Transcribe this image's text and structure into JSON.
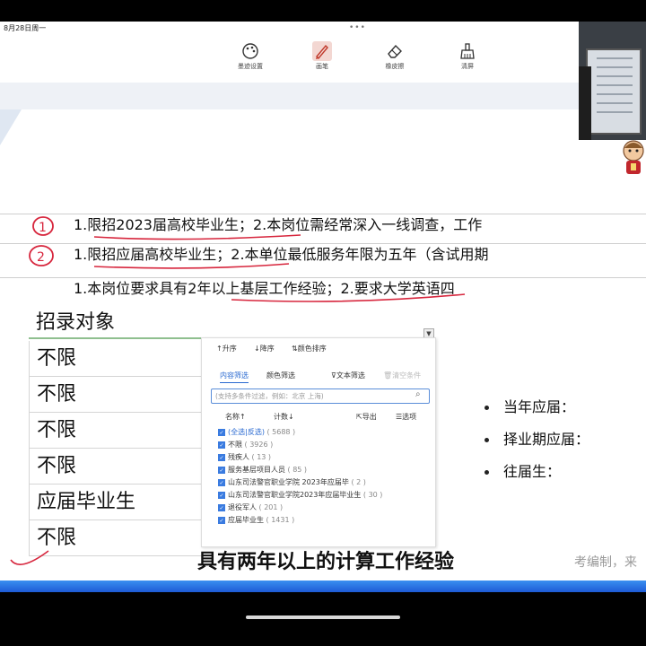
{
  "status_bar": {
    "date": "8月28日周一",
    "dots": "•••"
  },
  "toolbar": {
    "ink_settings": "墨迹设置",
    "pen": "画笔",
    "eraser": "橡皮擦",
    "clear": "清屏"
  },
  "rows": [
    {
      "text": "1.限招2023届高校毕业生；2.本岗位需经常深入一线调查，工作"
    },
    {
      "text": "1.限招应届高校毕业生；2.本单位最低服务年限为五年（含试用期"
    },
    {
      "text": "1.本岗位要求具有2年以上基层工作经验；2.要求大学英语四"
    }
  ],
  "table": {
    "header": "招录对象",
    "cells": [
      "不限",
      "不限",
      "不限",
      "不限",
      "应届毕业生",
      "不限"
    ],
    "dropdown_glyph": "▼"
  },
  "filter_panel": {
    "sort_asc": "升序",
    "sort_desc": "降序",
    "sort_color": "颜色排序",
    "tab_content": "内容筛选",
    "tab_color": "颜色筛选",
    "text_filter": "文本筛选",
    "clear_conditions": "清空条件",
    "search_placeholder": "(支持多条件过滤，例如：北京 上海)",
    "col_name": "名称↑",
    "col_count": "计数↓",
    "export": "导出",
    "options": "选项",
    "select_all": "全选",
    "invert": "反选",
    "items": [
      {
        "label": "(全选|反选)",
        "count": "( 5688 )"
      },
      {
        "label": "不限",
        "count": "( 3926 )"
      },
      {
        "label": "残疾人",
        "count": "( 13 )"
      },
      {
        "label": "服务基层项目人员",
        "count": "( 85 )"
      },
      {
        "label": "山东司法警官职业学院 2023年应届毕",
        "count": "( 2 )"
      },
      {
        "label": "山东司法警官职业学院2023年应届毕业生",
        "count": "( 30 )"
      },
      {
        "label": "退役军人",
        "count": "( 201 )"
      },
      {
        "label": "应届毕业生",
        "count": "( 1431 )"
      }
    ]
  },
  "bullets": [
    "当年应届：",
    "择业期应届：",
    "往届生："
  ],
  "subtitle": "具有两年以上的计算工作经验",
  "watermark": "考编制，来",
  "annotations": {
    "circle_1": "1",
    "circle_2": "2"
  },
  "colors": {
    "accent_blue": "#2a6ad1",
    "ink_red": "#d7263d",
    "bar_blue": "#1e5bd6"
  }
}
